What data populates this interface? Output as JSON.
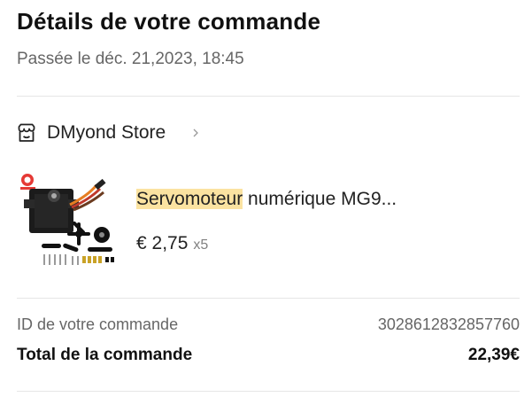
{
  "header": {
    "title": "Détails de votre commande",
    "placed": "Passée le déc. 21,2023, 18:45"
  },
  "store": {
    "name": "DMyond Store",
    "icon": "store-icon"
  },
  "item": {
    "name_highlight": "Servomoteur",
    "name_rest": " numérique MG9...",
    "price": "€ 2,75",
    "quantity": "x5",
    "highlight_color": "#fbe3a1"
  },
  "summary": {
    "order_id_label": "ID de votre commande",
    "order_id_value": "3028612832857760",
    "total_label": "Total de la commande",
    "total_value": "22,39€"
  }
}
